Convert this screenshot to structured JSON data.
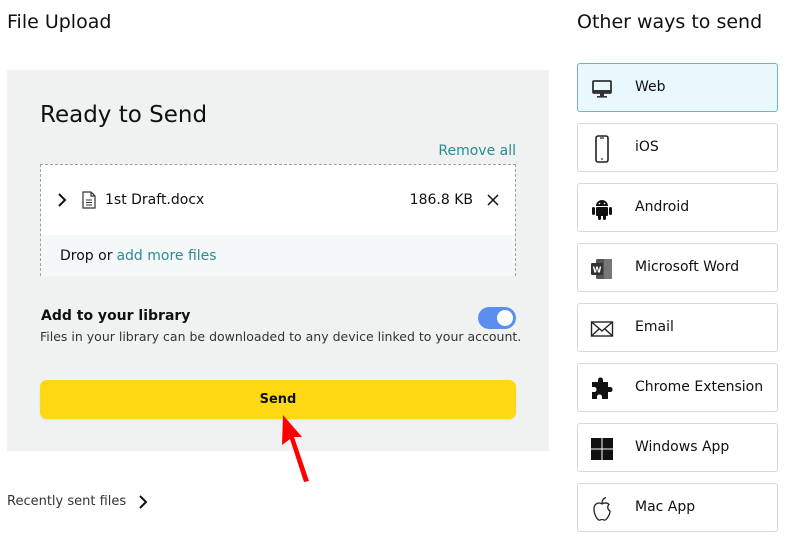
{
  "header": {
    "title": "File Upload",
    "side_title": "Other ways to send"
  },
  "panel": {
    "heading": "Ready to Send",
    "remove_all": "Remove all",
    "files": [
      {
        "name": "1st Draft.docx",
        "size": "186.8 KB"
      }
    ],
    "drop_text": "Drop or",
    "add_more_link": "add more files",
    "library": {
      "title": "Add to your library",
      "description": "Files in your library can be downloaded to any device linked to your account.",
      "enabled": true
    },
    "send_label": "Send"
  },
  "recent_link": "Recently sent files",
  "other_ways": [
    {
      "label": "Web",
      "icon": "monitor-icon",
      "active": true
    },
    {
      "label": "iOS",
      "icon": "phone-icon",
      "active": false
    },
    {
      "label": "Android",
      "icon": "android-icon",
      "active": false
    },
    {
      "label": "Microsoft Word",
      "icon": "word-icon",
      "active": false
    },
    {
      "label": "Email",
      "icon": "envelope-icon",
      "active": false
    },
    {
      "label": "Chrome Extension",
      "icon": "puzzle-icon",
      "active": false
    },
    {
      "label": "Windows App",
      "icon": "windows-icon",
      "active": false
    },
    {
      "label": "Mac App",
      "icon": "apple-icon",
      "active": false
    }
  ],
  "colors": {
    "accent_link": "#2a8b94",
    "send_button": "#ffd814",
    "toggle_on": "#5a8ff0",
    "annotation_arrow": "#ff0000"
  }
}
